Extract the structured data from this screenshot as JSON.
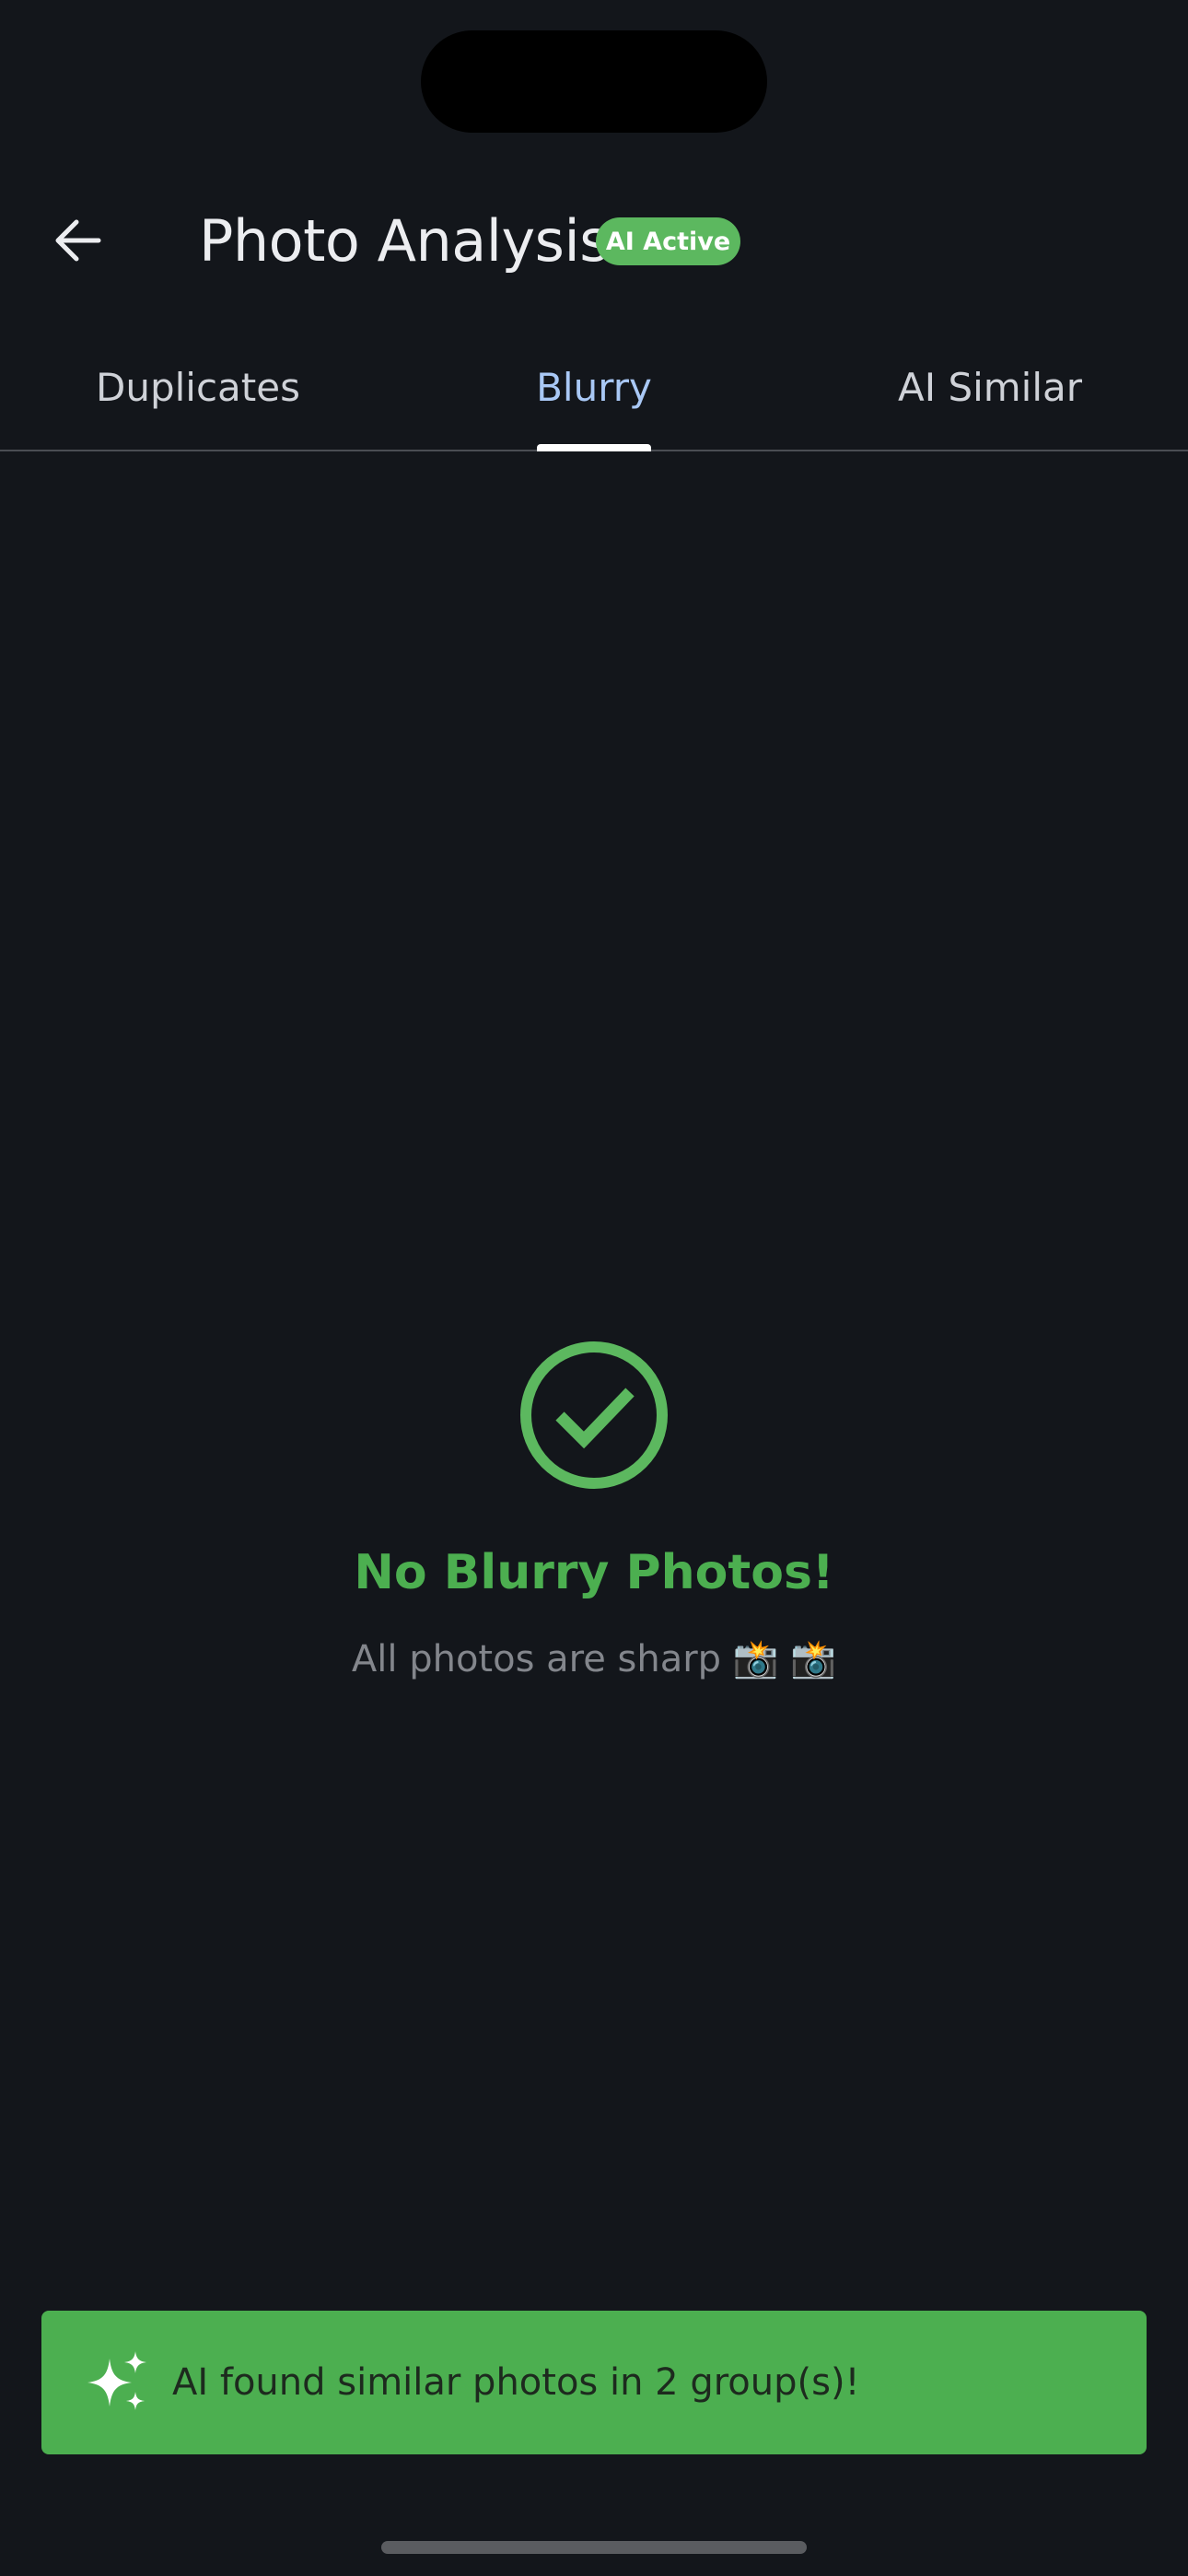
{
  "header": {
    "title": "Photo Analysis",
    "badge": "AI Active",
    "back_icon": "arrow-left-icon"
  },
  "tabs": [
    {
      "label": "Duplicates",
      "active": false
    },
    {
      "label": "Blurry",
      "active": true
    },
    {
      "label": "AI Similar",
      "active": false
    }
  ],
  "empty_state": {
    "icon": "check-circle-icon",
    "title": "No Blurry Photos!",
    "subtitle": "All photos are sharp 📸 📸"
  },
  "snackbar": {
    "icon": "sparkles-icon",
    "message": "AI found similar photos in 2 group(s)!"
  },
  "colors": {
    "background": "#13161b",
    "accent_green": "#4caf50",
    "badge_green": "#5cb85f",
    "active_tab": "#a9c8f5"
  }
}
